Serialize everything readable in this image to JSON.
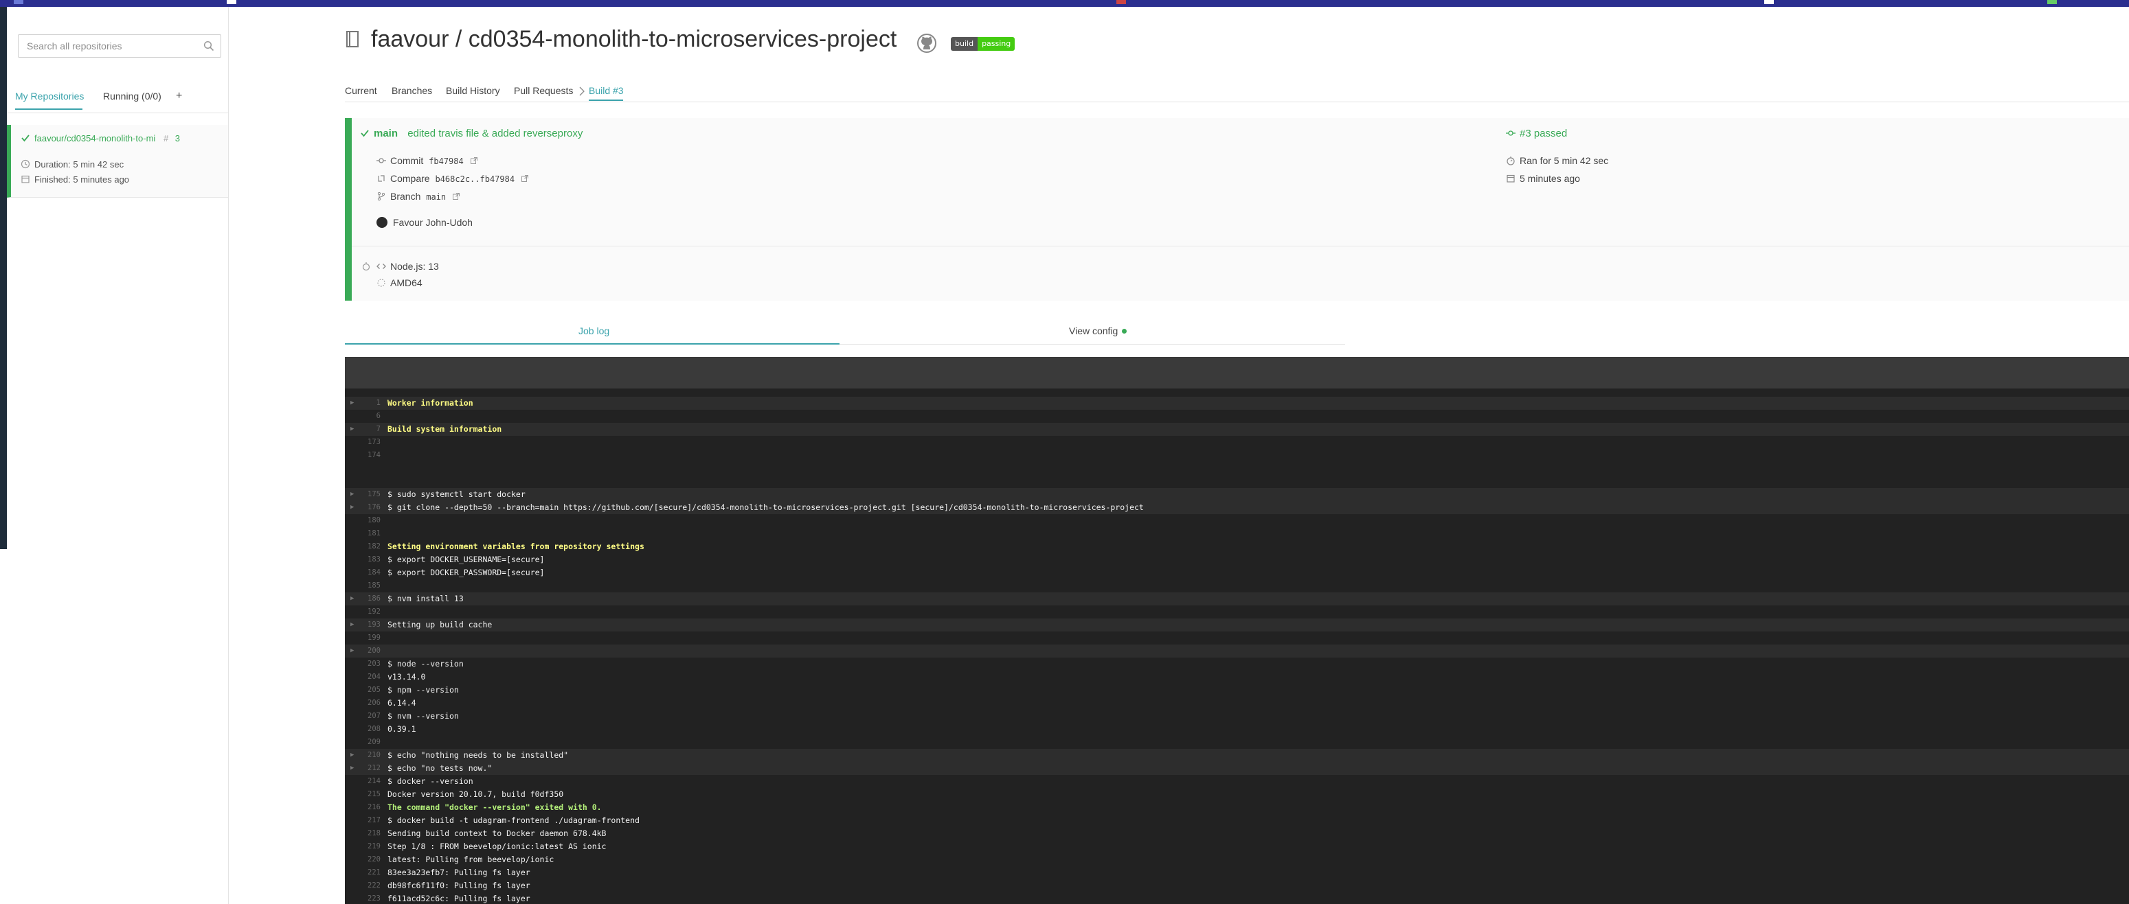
{
  "sidebar": {
    "search_placeholder": "Search all repositories",
    "tabs": {
      "my_repos": "My Repositories",
      "running": "Running (0/0)",
      "add": "+"
    },
    "repo": {
      "name": "faavour/cd0354-monolith-to-mi",
      "hash": "#",
      "build_number": "3",
      "duration": "Duration: 5 min 42 sec",
      "finished": "Finished: 5 minutes ago"
    }
  },
  "header": {
    "title": "faavour / cd0354-monolith-to-microservices-project",
    "badge_left": "build",
    "badge_right": "passing"
  },
  "nav": {
    "current": "Current",
    "branches": "Branches",
    "history": "Build History",
    "pulls": "Pull Requests",
    "build": "Build #3"
  },
  "build": {
    "branch": "main",
    "message": "edited travis file & added reverseproxy",
    "status": "#3 passed",
    "commit_label": "Commit",
    "commit": "fb47984",
    "compare_label": "Compare",
    "compare": "b468c2c..fb47984",
    "branch_label": "Branch",
    "branch_value": "main",
    "author": "Favour John-Udoh",
    "ran_for": "Ran for 5 min 42 sec",
    "ago": "5 minutes ago",
    "language": "Node.js: 13",
    "arch": "AMD64"
  },
  "job_tabs": {
    "log": "Job log",
    "config": "View config"
  },
  "log": [
    {
      "n": "1",
      "t": "Worker information",
      "s": "yellow",
      "f": true
    },
    {
      "n": "6",
      "t": "",
      "s": "",
      "f": false
    },
    {
      "n": "7",
      "t": "Build system information",
      "s": "yellow",
      "f": true
    },
    {
      "n": "173",
      "t": "",
      "s": "",
      "f": false
    },
    {
      "n": "174",
      "t": "",
      "s": "",
      "f": false
    },
    {
      "n": "",
      "t": "",
      "s": "",
      "f": false
    },
    {
      "n": "",
      "t": "",
      "s": "",
      "f": false
    },
    {
      "n": "175",
      "t": "$ sudo systemctl start docker",
      "s": "",
      "f": true
    },
    {
      "n": "176",
      "t": "$ git clone --depth=50 --branch=main https://github.com/[secure]/cd0354-monolith-to-microservices-project.git [secure]/cd0354-monolith-to-microservices-project",
      "s": "",
      "f": true
    },
    {
      "n": "180",
      "t": "",
      "s": "",
      "f": false
    },
    {
      "n": "181",
      "t": "",
      "s": "",
      "f": false
    },
    {
      "n": "182",
      "t": "Setting environment variables from repository settings",
      "s": "yellow",
      "f": false
    },
    {
      "n": "183",
      "t": "$ export DOCKER_USERNAME=[secure]",
      "s": "",
      "f": false
    },
    {
      "n": "184",
      "t": "$ export DOCKER_PASSWORD=[secure]",
      "s": "",
      "f": false
    },
    {
      "n": "185",
      "t": "",
      "s": "",
      "f": false
    },
    {
      "n": "186",
      "t": "$ nvm install 13",
      "s": "",
      "f": true
    },
    {
      "n": "192",
      "t": "",
      "s": "",
      "f": false
    },
    {
      "n": "193",
      "t": "Setting up build cache",
      "s": "",
      "f": true
    },
    {
      "n": "199",
      "t": "",
      "s": "",
      "f": false
    },
    {
      "n": "200",
      "t": "",
      "s": "",
      "f": true
    },
    {
      "n": "203",
      "t": "$ node --version",
      "s": "",
      "f": false
    },
    {
      "n": "204",
      "t": "v13.14.0",
      "s": "",
      "f": false
    },
    {
      "n": "205",
      "t": "$ npm --version",
      "s": "",
      "f": false
    },
    {
      "n": "206",
      "t": "6.14.4",
      "s": "",
      "f": false
    },
    {
      "n": "207",
      "t": "$ nvm --version",
      "s": "",
      "f": false
    },
    {
      "n": "208",
      "t": "0.39.1",
      "s": "",
      "f": false
    },
    {
      "n": "209",
      "t": "",
      "s": "",
      "f": false
    },
    {
      "n": "210",
      "t": "$ echo \"nothing needs to be installed\"",
      "s": "",
      "f": true
    },
    {
      "n": "212",
      "t": "$ echo \"no tests now.\"",
      "s": "",
      "f": true
    },
    {
      "n": "214",
      "t": "$ docker --version",
      "s": "",
      "f": false
    },
    {
      "n": "215",
      "t": "Docker version 20.10.7, build f0df350",
      "s": "",
      "f": false
    },
    {
      "n": "216",
      "t": "The command \"docker --version\" exited with 0.",
      "s": "greenl",
      "f": false
    },
    {
      "n": "217",
      "t": "$ docker build -t udagram-frontend ./udagram-frontend",
      "s": "",
      "f": false
    },
    {
      "n": "218",
      "t": "Sending build context to Docker daemon  678.4kB",
      "s": "",
      "f": false
    },
    {
      "n": "219",
      "t": "Step 1/8 : FROM beevelop/ionic:latest AS ionic",
      "s": "",
      "f": false
    },
    {
      "n": "220",
      "t": "latest: Pulling from beevelop/ionic",
      "s": "",
      "f": false
    },
    {
      "n": "221",
      "t": "83ee3a23efb7: Pulling fs layer",
      "s": "",
      "f": false
    },
    {
      "n": "222",
      "t": "db98fc6f11f0: Pulling fs layer",
      "s": "",
      "f": false
    },
    {
      "n": "223",
      "t": "f611acd52c6c: Pulling fs layer",
      "s": "",
      "f": false
    }
  ]
}
